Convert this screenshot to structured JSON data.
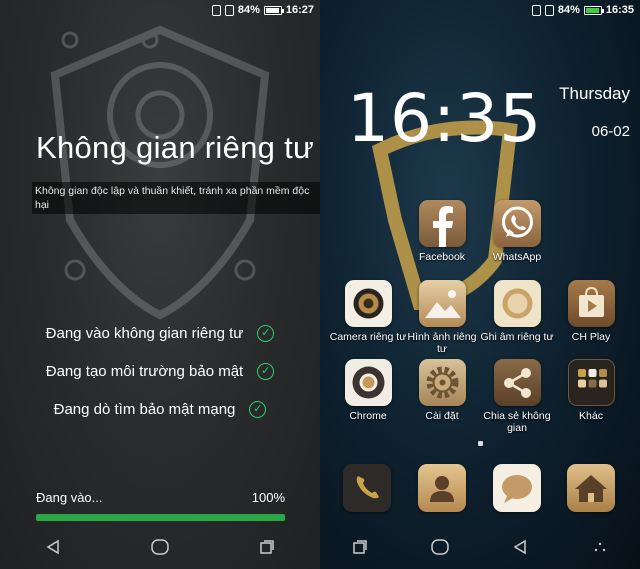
{
  "left_screen": {
    "status": {
      "battery": "84%",
      "time": "16:27"
    },
    "title": "Không gian riêng tư",
    "description": "Không gian độc lập và thuần khiết, tránh xa phần mềm độc hại",
    "steps": [
      {
        "label": "Đang vào không gian riêng tư"
      },
      {
        "label": "Đang tạo môi trường bảo mật"
      },
      {
        "label": "Đang dò tìm bảo mật mạng"
      }
    ],
    "progress": {
      "label": "Đang vào...",
      "percent_text": "100%",
      "value": 1.0
    },
    "nav_icons": [
      "back-icon",
      "home-icon",
      "recents-icon"
    ]
  },
  "right_screen": {
    "status": {
      "battery": "84%",
      "time": "16:35"
    },
    "clock": "16:35",
    "weekday": "Thursday",
    "date": "06-02",
    "apps": [
      {
        "label": "Facebook",
        "icon": "facebook-icon"
      },
      {
        "label": "WhatsApp",
        "icon": "whatsapp-icon"
      },
      {
        "label": "Camera riêng tư",
        "icon": "camera-icon"
      },
      {
        "label": "Hình ảnh riêng tư",
        "icon": "gallery-icon"
      },
      {
        "label": "Ghi âm riêng tư",
        "icon": "recorder-icon"
      },
      {
        "label": "CH Play",
        "icon": "play-store-icon"
      },
      {
        "label": "Chrome",
        "icon": "chrome-icon"
      },
      {
        "label": "Cài đặt",
        "icon": "settings-gear-icon"
      },
      {
        "label": "Chia sẻ không gian",
        "icon": "share-icon"
      },
      {
        "label": "Khác",
        "icon": "folder-icon"
      }
    ],
    "dock": [
      "phone-icon",
      "contacts-icon",
      "messages-icon",
      "home-app-icon"
    ],
    "nav_icons": [
      "recents-icon",
      "home-icon",
      "back-icon",
      "menu-icon"
    ],
    "colors": {
      "accent_gold": "#c9a24a",
      "progress_green": "#2aa845",
      "check_green": "#2ecc71"
    }
  }
}
